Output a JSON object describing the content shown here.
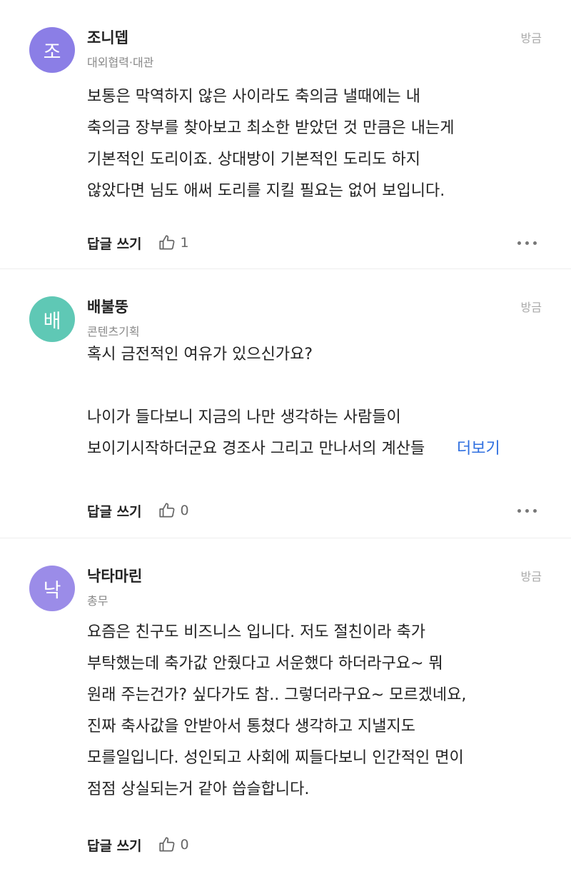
{
  "comments": [
    {
      "avatar_char": "조",
      "avatar_color": "#8b7ee6",
      "name": "조니뎁",
      "dept": "대외협력·대관",
      "time": "방금",
      "lines": [
        "보통은 막역하지 않은 사이라도 축의금 낼때에는 내",
        "축의금 장부를 찾아보고 최소한 받았던 것 만큼은 내는게",
        "기본적인 도리이죠. 상대방이 기본적인 도리도 하지",
        "않았다면 님도 애써 도리를 지킬 필요는 없어 보입니다."
      ],
      "reply_label": "답글 쓰기",
      "likes": "1"
    },
    {
      "avatar_char": "배",
      "avatar_color": "#5fc8b5",
      "name": "배불뚱",
      "dept": "콘텐츠기획",
      "time": "방금",
      "lines": [
        "혹시 금전적인 여유가 있으신가요?",
        "",
        "나이가 들다보니 지금의 나만 생각하는 사람들이"
      ],
      "last_line": "보이기시작하더군요 경조사 그리고 만나서의 계산들",
      "more_label": "더보기",
      "reply_label": "답글 쓰기",
      "likes": "0"
    },
    {
      "avatar_char": "낙",
      "avatar_color": "#9b8ce8",
      "name": "낙타마린",
      "dept": "총무",
      "time": "방금",
      "lines": [
        "요즘은 친구도 비즈니스 입니다. 저도 절친이라 축가",
        "부탁했는데 축가값 안줬다고 서운했다 하더라구요~ 뭐",
        "원래 주는건가? 싶다가도 참.. 그렇더라구요~ 모르겠네요,",
        "진짜 축사값을 안받아서 통쳤다 생각하고 지낼지도",
        "모를일입니다. 성인되고 사회에 찌들다보니 인간적인 면이",
        "점점 상실되는거 같아 씁슬합니다."
      ],
      "reply_label": "답글 쓰기",
      "likes": "0"
    }
  ]
}
